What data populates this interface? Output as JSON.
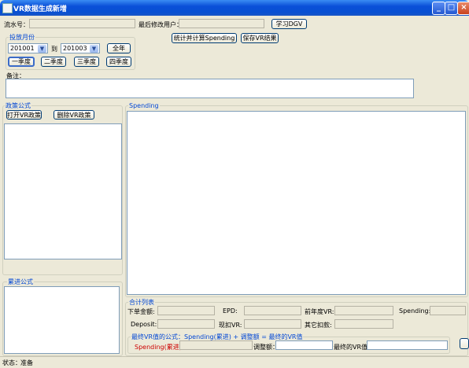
{
  "window": {
    "title": "VR数据生成新增",
    "minimize_glyph": "_",
    "maximize_glyph": "□",
    "close_glyph": "×"
  },
  "header": {
    "serial_label": "流水号：",
    "serial_value": "",
    "last_user_label": "最后修改用户：",
    "last_user_value": "",
    "learn_button": "学习DGV",
    "calc_button": "统计并计算Spending",
    "save_button": "保存VR结果"
  },
  "period": {
    "group_title": "投放月份",
    "from_value": "201001",
    "to_label": "到",
    "to_value": "201003",
    "full_year_button": "全年",
    "quarters": [
      "一季度",
      "二季度",
      "三季度",
      "四季度"
    ],
    "selected_quarter": "一季度"
  },
  "remarks": {
    "label": "备注：",
    "value": ""
  },
  "policy": {
    "group_title": "政策公式",
    "open_button": "打开VR政策",
    "delete_button": "删除VR政策"
  },
  "progressive": {
    "group_title": "累进公式"
  },
  "spending": {
    "group_title": "Spending"
  },
  "totals": {
    "group_title": "合计列表",
    "fields": [
      {
        "label": "下单金额:",
        "value": ""
      },
      {
        "label": "EPD:",
        "value": ""
      },
      {
        "label": "前年度VR:",
        "value": ""
      },
      {
        "label": "Spending:",
        "value": ""
      },
      {
        "label": "Deposit:",
        "value": ""
      },
      {
        "label": "现扣VR:",
        "value": ""
      },
      {
        "label": "其它扣款:",
        "value": ""
      }
    ]
  },
  "final_formula": {
    "title": "最终VR值的公式：Spending(累进) + 调整额 = 最终的VR值",
    "spending_label": "Spending(累进)",
    "spending_value": "",
    "adjust_label": "调整额：",
    "adjust_value": "",
    "final_label": "最终的VR值:",
    "final_value": ""
  },
  "status": {
    "label": "状态：",
    "value": "准备"
  }
}
